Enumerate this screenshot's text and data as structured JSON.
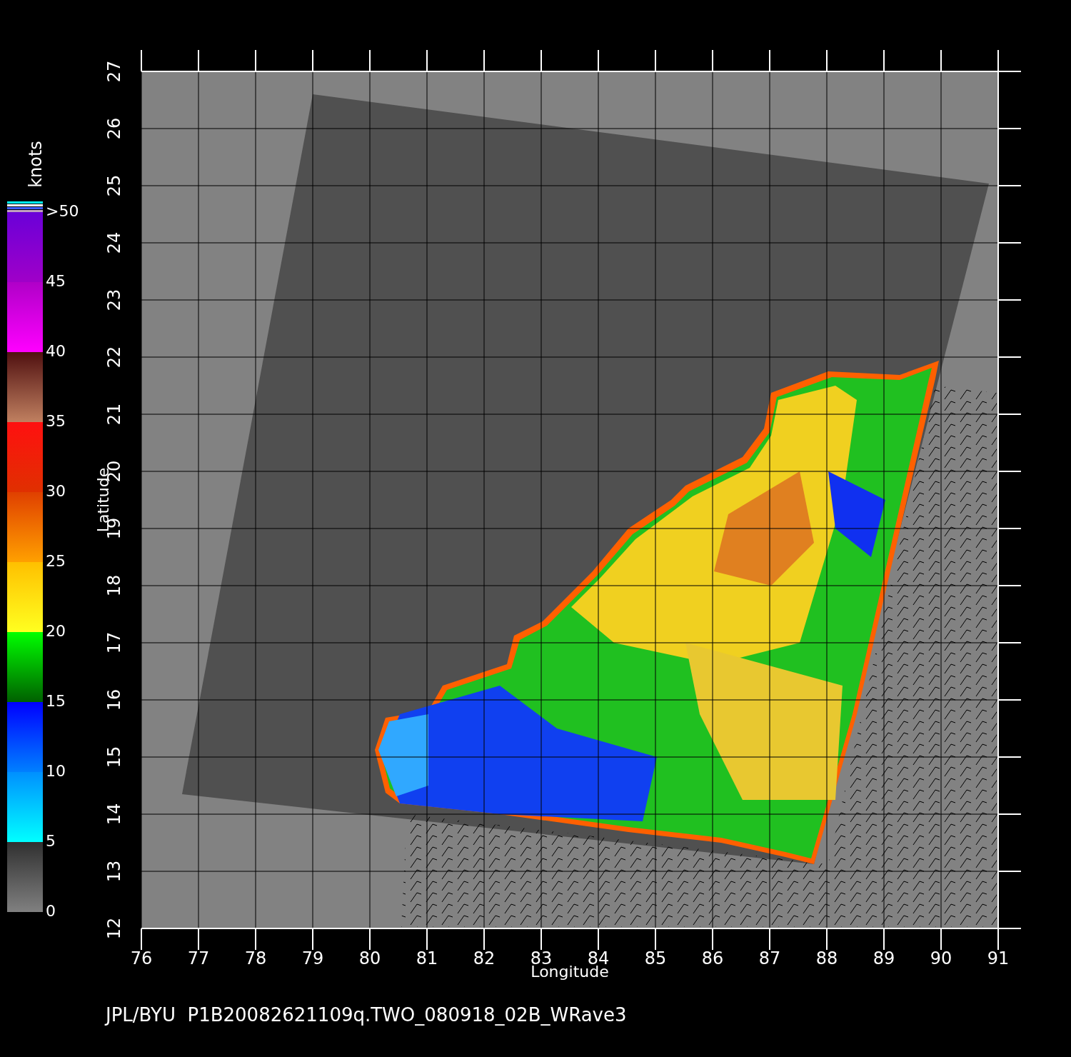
{
  "plot": {
    "caption": "JPL/BYU  P1B20082621109q.TWO_080918_02B_WRave3",
    "x_axis": {
      "title": "Longitude",
      "ticks": [
        "76",
        "77",
        "78",
        "79",
        "80",
        "81",
        "82",
        "83",
        "84",
        "85",
        "86",
        "87",
        "88",
        "89",
        "90",
        "91"
      ]
    },
    "y_axis": {
      "title": "Latitude",
      "ticks": [
        "12",
        "13",
        "14",
        "15",
        "16",
        "17",
        "18",
        "19",
        "20",
        "21",
        "22",
        "23",
        "24",
        "25",
        "26",
        "27"
      ]
    }
  },
  "color_scale": {
    "unit": "knots",
    "labels": [
      ">50",
      "45",
      "40",
      "35",
      "30",
      "25",
      "20",
      "15",
      "10",
      "5",
      "0"
    ]
  }
}
